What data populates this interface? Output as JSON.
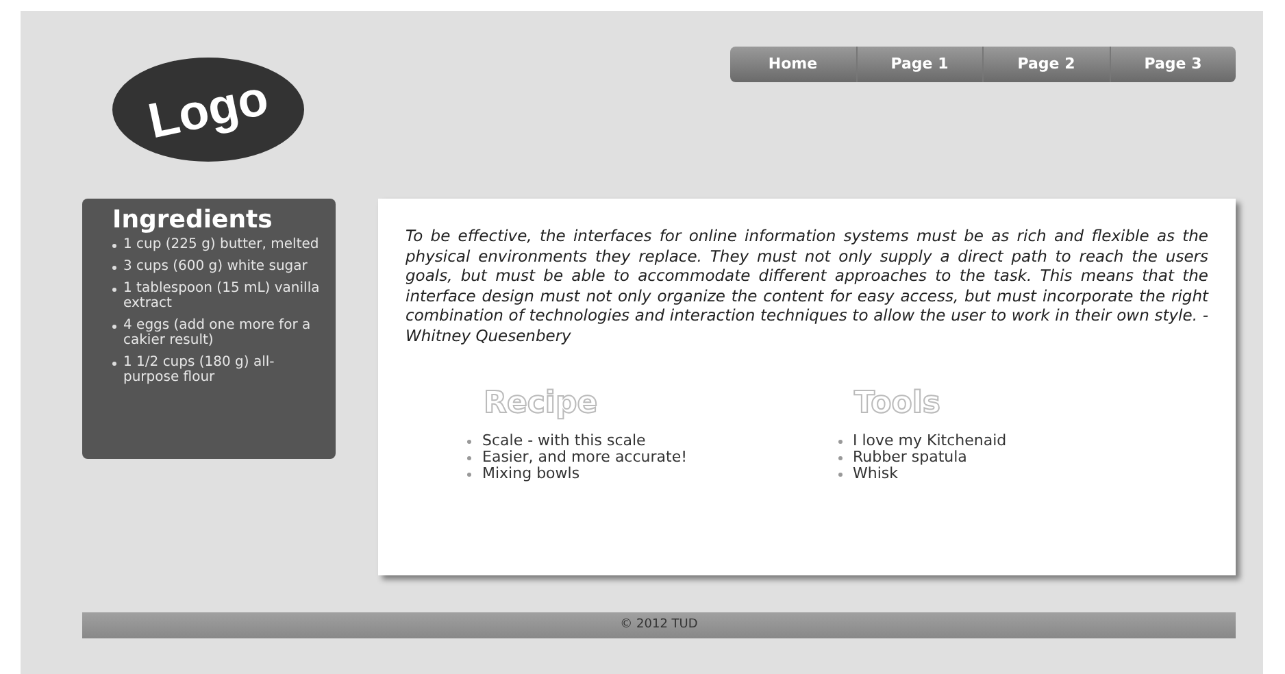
{
  "logo": {
    "text": "Logo"
  },
  "nav": {
    "items": [
      {
        "label": "Home"
      },
      {
        "label": "Page 1"
      },
      {
        "label": "Page 2"
      },
      {
        "label": "Page 3"
      }
    ]
  },
  "sidebar": {
    "title": "Ingredients",
    "items": [
      "1 cup (225 g) butter, melted",
      "3 cups (600 g) white sugar",
      "1 tablespoon (15 mL) vanilla extract",
      "4 eggs (add one more for a cakier result)",
      "1 1/2 cups (180 g) all-purpose flour"
    ]
  },
  "quote": "To be effective, the interfaces for online information systems must be as rich and flexible as the physical environments they replace. They must not only supply a direct path to reach the users goals, but must be able to accommodate different approaches to the task. This means that the interface design must not only organize the content for easy access, but must incorporate the right combination of technologies and interaction techniques to allow the user to work in their own style. - Whitney Quesenbery",
  "sections": [
    {
      "title": "Recipe",
      "items": [
        "Scale - with this scale",
        "Easier, and more accurate!",
        "Mixing bowls"
      ]
    },
    {
      "title": "Tools",
      "items": [
        "I love my Kitchenaid",
        "Rubber spatula",
        "Whisk"
      ]
    }
  ],
  "footer": "© 2012 TUD"
}
